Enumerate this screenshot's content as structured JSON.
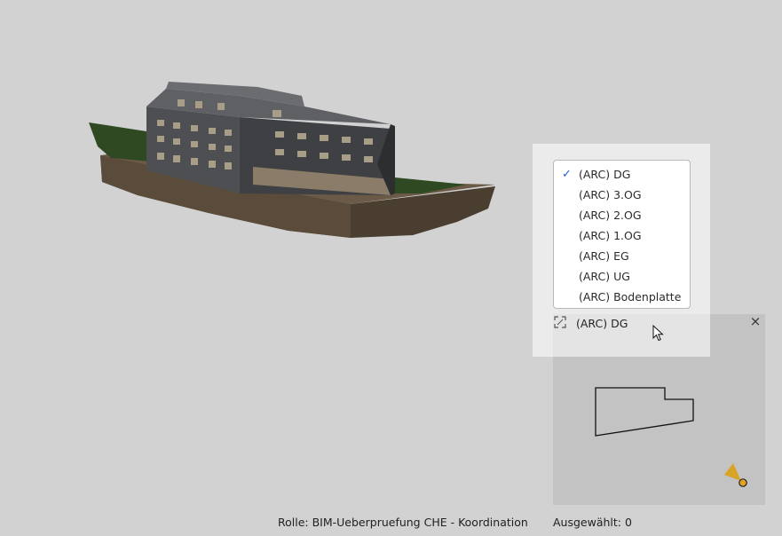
{
  "level_dropdown": {
    "items": [
      {
        "label": "(ARC) DG",
        "selected": true
      },
      {
        "label": "(ARC) 3.OG",
        "selected": false
      },
      {
        "label": "(ARC) 2.OG",
        "selected": false
      },
      {
        "label": "(ARC) 1.OG",
        "selected": false
      },
      {
        "label": "(ARC) EG",
        "selected": false
      },
      {
        "label": "(ARC) UG",
        "selected": false
      },
      {
        "label": "(ARC) Bodenplatte",
        "selected": false
      }
    ],
    "check_glyph": "✓"
  },
  "level_selector": {
    "current": "(ARC) DG",
    "expand_icon": "expand-icon"
  },
  "minimap": {
    "close_glyph": "×",
    "viewer_icon": "camera-viewpoint-icon",
    "viewer_color": "#d9a21f"
  },
  "status_bar": {
    "role": "Rolle: BIM-Ueberpruefung CHE - Koordination",
    "selected": "Ausgewählt: 0"
  },
  "colors": {
    "background": "#d2d2d2",
    "accent": "#1f5fd0"
  }
}
